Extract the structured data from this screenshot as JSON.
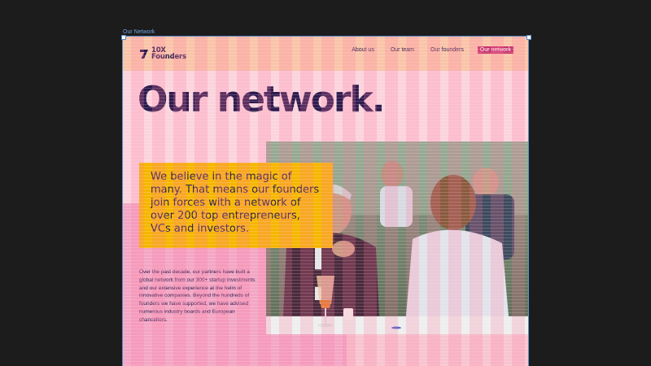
{
  "canvas": {
    "frame_label": "Our Network"
  },
  "header": {
    "logo_line1": "10X",
    "logo_line2": "Founders",
    "nav": [
      "About us",
      "Our team",
      "Our founders",
      "Our network"
    ],
    "active_nav": "Our network"
  },
  "hero": {
    "headline": "Our network.",
    "quote": "We believe in the magic of many. That means our founders join forces with a network  of over 200 top entrepreneurs, VCs and investors.",
    "body": "Over the past decade, our partners have built a global network from our 300+ startup investments and our extensive experience at the helm of innovative companies. Beyond the hundreds of founders we have supported, we have advised numerous industry boards and European chancellors."
  },
  "colors": {
    "brand_purple": "#2d1b4e",
    "accent_pink": "#c8306a",
    "quote_yellow": "#f6b600",
    "peach": "#f9c4a8",
    "pink": "#f3a6c4"
  }
}
